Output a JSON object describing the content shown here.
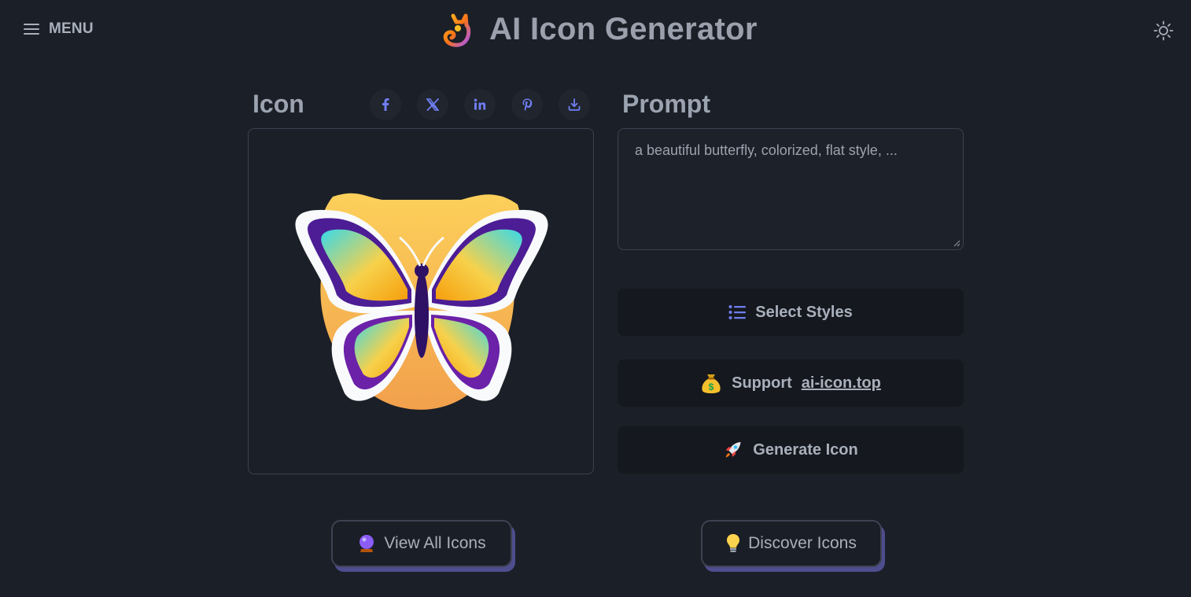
{
  "header": {
    "menu_label": "MENU",
    "title": "AI Icon Generator",
    "logo_icon": "cat-logo-icon",
    "theme_icon": "sun-icon"
  },
  "icon_section": {
    "title": "Icon",
    "share": [
      "facebook-icon",
      "x-icon",
      "linkedin-icon",
      "pinterest-icon",
      "download-icon"
    ],
    "image": "butterfly sticker icon"
  },
  "prompt_section": {
    "title": "Prompt",
    "value": "a beautiful butterfly, colorized, flat style, ..."
  },
  "actions": {
    "select_styles": "Select Styles",
    "support": "Support",
    "support_link": "ai-icon.top",
    "generate": "Generate Icon"
  },
  "footer": {
    "view_all": "View All Icons",
    "discover": "Discover Icons"
  },
  "colors": {
    "background": "#1b1f27",
    "accent": "#6366f1",
    "shadow": "#4e4d8e"
  }
}
